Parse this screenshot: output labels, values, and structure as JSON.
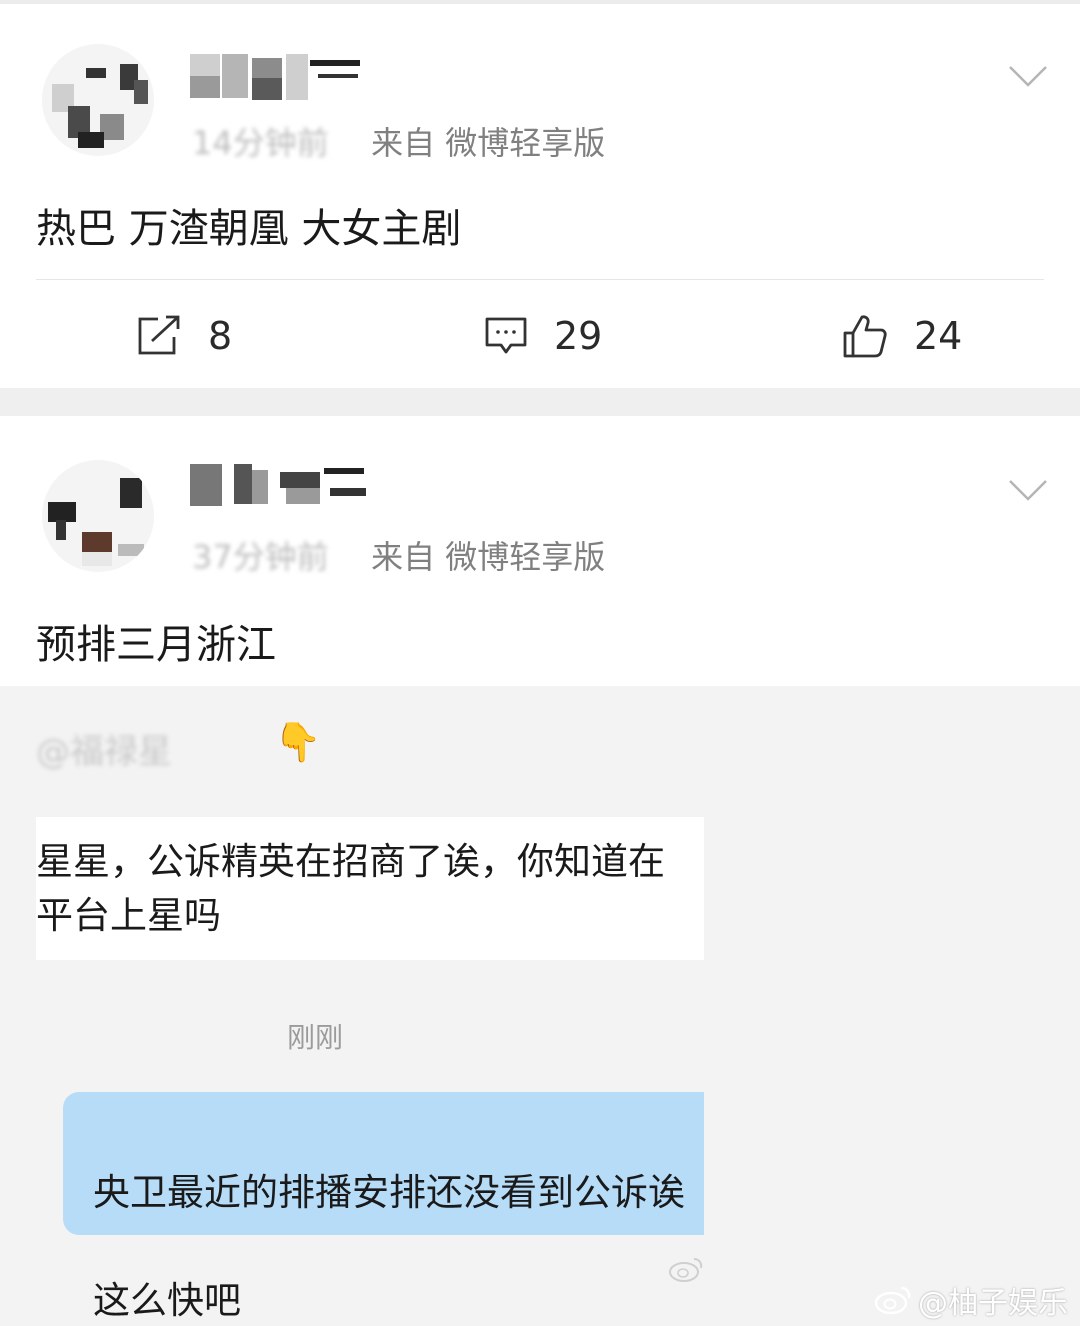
{
  "post1": {
    "author_name": "冈时星星",
    "meta_time": "14分钟前",
    "meta_source": "来自 微博轻享版",
    "text": "热巴 万渣朝凰 大女主剧",
    "actions": {
      "repost_count": "8",
      "comment_count": "29",
      "like_count": "24"
    }
  },
  "post2": {
    "author_name": "",
    "meta_time": "37分钟前",
    "meta_source": "来自 微博轻享版",
    "text": "预排三月浙江"
  },
  "chat": {
    "mention": "@福禄星",
    "mention_emoji": "👇",
    "incoming_line1": "星星，公诉精英在招商了诶，你知道在",
    "incoming_line2": "平台上星吗",
    "time": "刚刚",
    "outgoing_line1": "央卫最近的排播安排还没看到公诉诶",
    "outgoing_line2": "这么快吧"
  },
  "watermark": {
    "text": "@柚子娱乐"
  },
  "colors": {
    "page_bg": "#ffffff",
    "band": "#efefef",
    "chat_bg": "#f3f3f3",
    "outgoing_bubble": "#b7dcf8",
    "meta_gray": "#808080"
  },
  "icons": [
    "chevron-down-icon",
    "repost-icon",
    "comment-icon",
    "like-icon",
    "point-down-emoji",
    "weibo-logo-icon"
  ]
}
